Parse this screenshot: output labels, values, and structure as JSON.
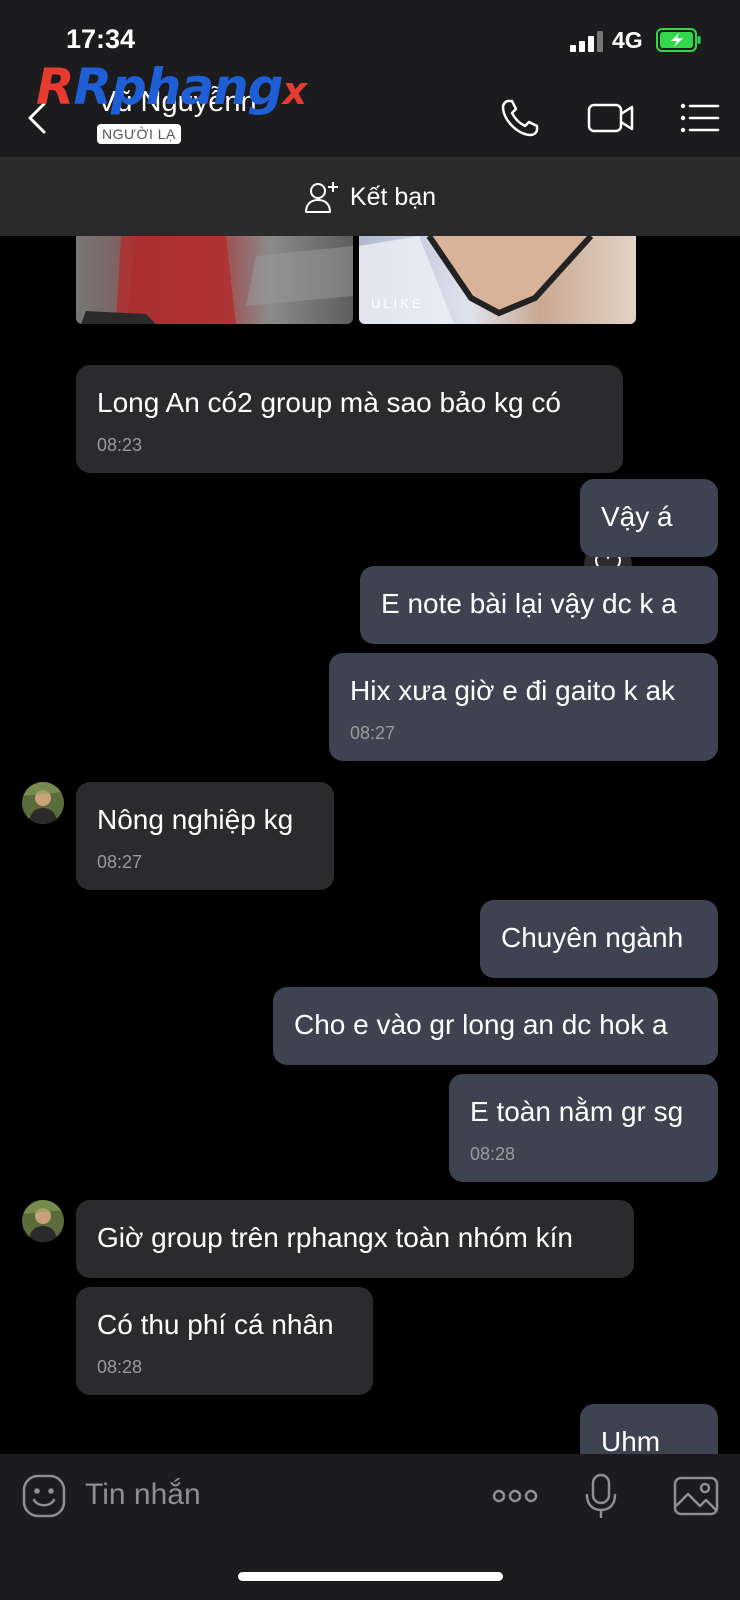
{
  "status_bar": {
    "time": "17:34",
    "network": "4G"
  },
  "header": {
    "contact_name": "Vũ Nguyễnn",
    "badge": "NGƯỜI LẠ",
    "logo_main": "Rphang",
    "logo_x": "x"
  },
  "friend_bar": {
    "label": "Kết bạn"
  },
  "photo_watermark": "ULIKE",
  "messages": [
    {
      "dir": "in",
      "text": "Long An có2 group mà sao bảo kg có",
      "time": "08:23"
    },
    {
      "dir": "out",
      "text": "Vậy á"
    },
    {
      "dir": "out",
      "text": "E note bài lại vậy dc k a"
    },
    {
      "dir": "out",
      "text": "Hix xưa giờ e đi gaito k ak",
      "time": "08:27"
    },
    {
      "dir": "in",
      "text": "Nông nghiệp kg",
      "time": "08:27"
    },
    {
      "dir": "out",
      "text": "Chuyên ngành"
    },
    {
      "dir": "out",
      "text": "Cho e vào gr long an dc hok a"
    },
    {
      "dir": "out",
      "text": "E toàn nằm gr sg",
      "time": "08:28"
    },
    {
      "dir": "in",
      "text": "Giờ group trên rphangx toàn nhóm kín"
    },
    {
      "dir": "in",
      "text": "Có thu phí cá nhân",
      "time": "08:28"
    },
    {
      "dir": "out",
      "text": "Uhm"
    }
  ],
  "composer": {
    "placeholder": "Tin nhắn"
  },
  "icons": {
    "back": "chevron-left-icon",
    "call": "phone-icon",
    "video": "video-icon",
    "menu": "list-icon",
    "add_friend": "add-user-icon",
    "react": "heart-icon",
    "emoji": "emoji-icon",
    "more": "more-dots-icon",
    "mic": "microphone-icon",
    "image": "image-icon"
  },
  "colors": {
    "background": "#000000",
    "bar": "#1c1c1e",
    "incoming_bubble": "#2b2b2d",
    "outgoing_bubble": "#3d4350",
    "logo_red": "#e63b2e",
    "logo_blue": "#1f5fd6"
  }
}
